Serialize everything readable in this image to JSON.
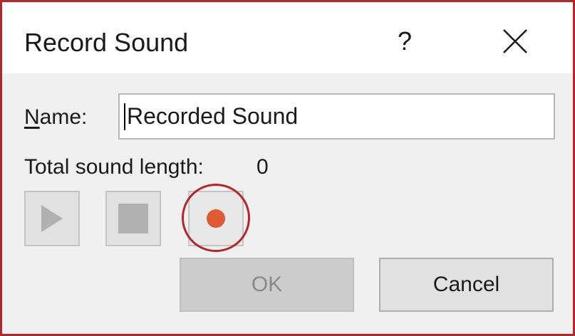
{
  "dialog": {
    "title": "Record Sound",
    "help_label": "?",
    "border_color": "#b3272a"
  },
  "name_field": {
    "label_accel": "N",
    "label_rest": "ame:",
    "value": "Recorded Sound"
  },
  "sound_length": {
    "label": "Total sound length:",
    "value": "0"
  },
  "controls": {
    "play_icon": "play-icon",
    "stop_icon": "stop-icon",
    "record_icon": "record-icon",
    "record_color": "#e05a33",
    "disabled_icon_color": "#b0b0b0"
  },
  "buttons": {
    "ok_label": "OK",
    "cancel_label": "Cancel"
  }
}
